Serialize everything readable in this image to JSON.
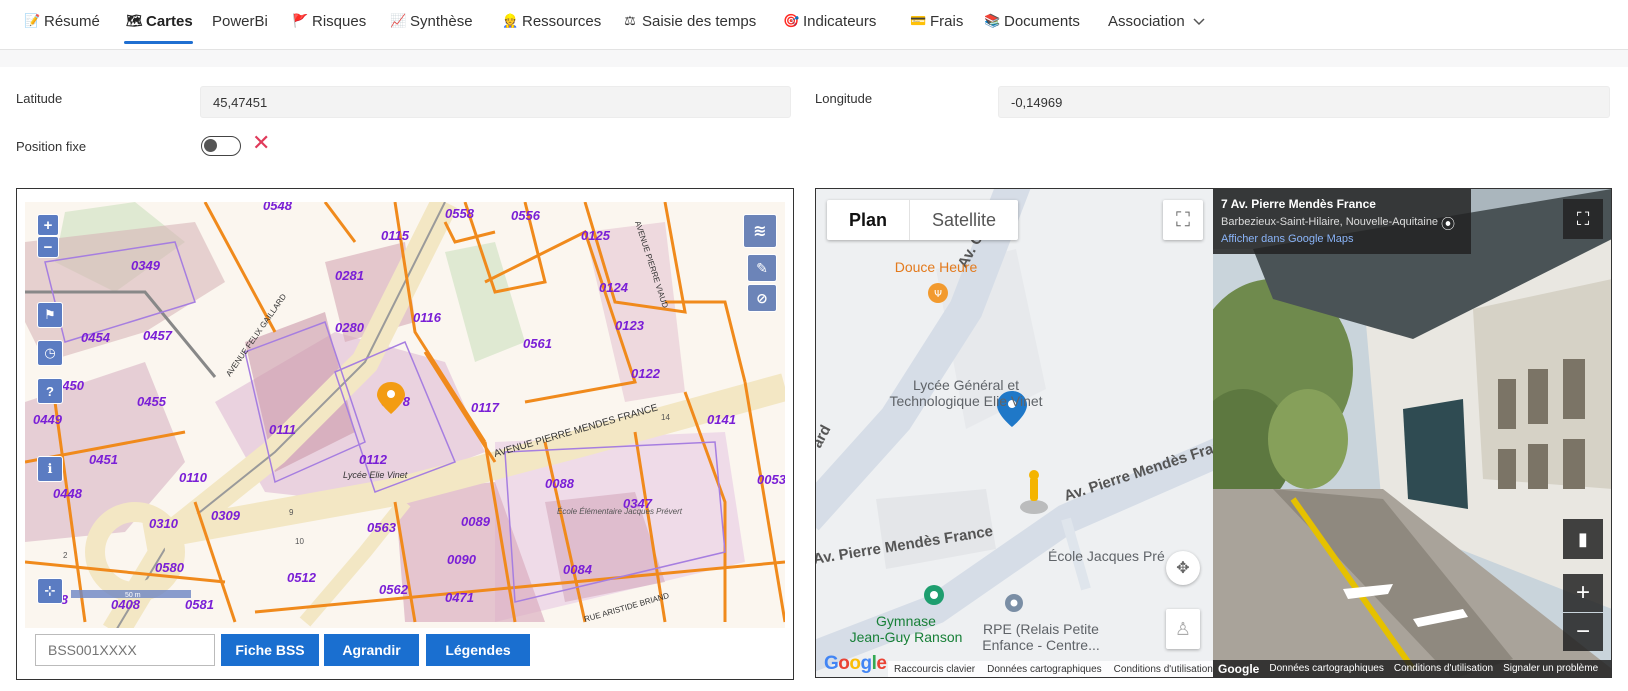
{
  "nav": {
    "tabs": [
      {
        "label": "Résumé",
        "icon": "memo-icon",
        "glyph": "📝"
      },
      {
        "label": "Cartes",
        "icon": "map-icon",
        "glyph": "🗺"
      },
      {
        "label": "PowerBi",
        "icon": "",
        "glyph": ""
      },
      {
        "label": "Risques",
        "icon": "flag-icon",
        "glyph": "🚩"
      },
      {
        "label": "Synthèse",
        "icon": "chart-icon",
        "glyph": "📈"
      },
      {
        "label": "Ressources",
        "icon": "worker-icon",
        "glyph": "👷"
      },
      {
        "label": "Saisie des temps",
        "icon": "scale-icon",
        "glyph": "⚖"
      },
      {
        "label": "Indicateurs",
        "icon": "target-icon",
        "glyph": "🎯"
      },
      {
        "label": "Frais",
        "icon": "card-icon",
        "glyph": "💳"
      },
      {
        "label": "Documents",
        "icon": "books-icon",
        "glyph": "📚"
      },
      {
        "label": "Association",
        "icon": "chevron-down-icon",
        "glyph": "⌄"
      }
    ],
    "active": "Cartes"
  },
  "form": {
    "latitude_label": "Latitude",
    "latitude_value": "45,47451",
    "longitude_label": "Longitude",
    "longitude_value": "-0,14969",
    "fixed_label": "Position fixe",
    "fixed_on": false
  },
  "cadastre": {
    "parcels": [
      "0548",
      "0558",
      "0556",
      "0115",
      "0125",
      "0349",
      "0281",
      "0124",
      "0454",
      "0457",
      "0280",
      "0116",
      "0561",
      "0123",
      "0450",
      "0122",
      "0455",
      "0478",
      "0117",
      "0449",
      "0111",
      "0141",
      "0112",
      "0451",
      "0110",
      "0053",
      "0448",
      "0088",
      "0347",
      "0310",
      "0309",
      "0563",
      "0089",
      "0090",
      "0084",
      "0580",
      "0512",
      "0562",
      "0458",
      "0408",
      "0581",
      "0471"
    ],
    "streets": [
      "AVENUE PIERRE MENDES FRANCE",
      "AVENUE FELIX GAILLARD",
      "AVENUE PIERRE VIAUD",
      "RUE ARISTIDE BRIAND"
    ],
    "places": [
      "Lycée Elie Vinet",
      "École Élémentaire Jacques Prévert"
    ],
    "numbers": [
      "14",
      "9",
      "2",
      "10"
    ],
    "scale_label": "50 m"
  },
  "bss": {
    "input_placeholder": "BSS001XXXX",
    "btn_fiche": "Fiche BSS",
    "btn_agrandir": "Agrandir",
    "btn_legendes": "Légendes"
  },
  "gmap": {
    "type_plan": "Plan",
    "type_satellite": "Satellite",
    "poi_restaurant": "Douce Heure",
    "poi_lycee_1": "Lycée Général et",
    "poi_lycee_2": "Technologique Elie Vinet",
    "street_main": "Av. Pierre Mendès France",
    "street_top": "Av. G",
    "street_left": "ard",
    "poi_ecole": "École Jacques Pré",
    "poi_gym_1": "Gymnase",
    "poi_gym_2": "Jean-Guy Ranson",
    "poi_rpe_1": "RPE (Relais Petite",
    "poi_rpe_2": "Enfance - Centre...",
    "logo": "Google",
    "footer": [
      "Raccourcis clavier",
      "Données cartographiques",
      "Conditions d'utilisation"
    ]
  },
  "streetview": {
    "address": "7 Av. Pierre Mendès France",
    "locality": "Barbezieux-Saint-Hilaire, Nouvelle-Aquitaine",
    "link": "Afficher dans Google Maps",
    "logo": "Google",
    "footer": [
      "Données cartographiques",
      "Conditions d'utilisation",
      "Signaler un problème"
    ]
  },
  "colors": {
    "accent": "#1f6fd1",
    "button_blue": "#1a6fd0",
    "parcel_orange": "#f08a1c",
    "parcel_label": "#7a1fd6",
    "close_red": "#e03a5a"
  }
}
